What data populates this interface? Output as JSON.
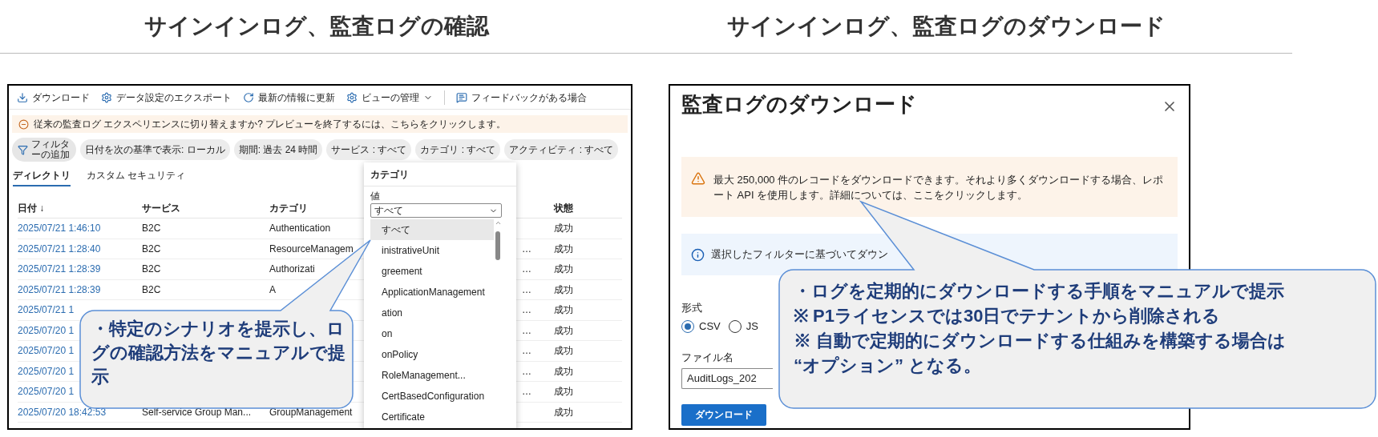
{
  "titles": [
    "サインインログ、監査ログの確認",
    "サインインログ、監査ログのダウンロード"
  ],
  "audit_view": {
    "toolbar": [
      {
        "kind": "download",
        "label": "ダウンロード"
      },
      {
        "kind": "export",
        "label": "データ設定のエクスポート"
      },
      {
        "kind": "refresh",
        "label": "最新の情報に更新"
      },
      {
        "kind": "view",
        "label": "ビューの管理"
      },
      {
        "kind": "feedback",
        "label": "フィードバックがある場合"
      }
    ],
    "banner": "従来の監査ログ エクスペリエンスに切り替えますか? プレビューを終了するには、こちらをクリックします。",
    "add_filter": "フィルターの追加",
    "filters": [
      "日付を次の基準で表示: ローカル",
      "期間: 過去 24 時間",
      "サービス : すべて",
      "カテゴリ : すべて",
      "アクティビティ : すべて"
    ],
    "tabs": [
      {
        "label": "ディレクトリ",
        "selected": true
      },
      {
        "label": "カスタム セキュリティ",
        "selected": false
      }
    ],
    "table": {
      "columns": [
        "日付 ↓",
        "サービス",
        "カテゴリ",
        "状態"
      ],
      "rows": [
        {
          "date": "2025/07/21 1:46:10",
          "service": "B2C",
          "category": "Authentication",
          "status": "成功"
        },
        {
          "date": "2025/07/21 1:28:40",
          "service": "B2C",
          "category": "ResourceManagem",
          "column_4": "…",
          "status": "成功"
        },
        {
          "date": "2025/07/21 1:28:39",
          "service": "B2C",
          "category": "Authorizati",
          "column_4": "…",
          "status": "成功"
        },
        {
          "date": "2025/07/21 1:28:39",
          "service": "B2C",
          "category": "A",
          "column_4": "…",
          "status": "成功"
        },
        {
          "date": "2025/07/21 1",
          "column_4": "…",
          "status": "成功"
        },
        {
          "date": "2025/07/20 1",
          "column_4": "…",
          "status": "成功"
        },
        {
          "date": "2025/07/20 1",
          "column_4": "…",
          "status": "成功"
        },
        {
          "date": "2025/07/20 1",
          "column_4": "…",
          "status": "成功"
        },
        {
          "date": "2025/07/20 1",
          "column_4": "…",
          "status": "成功"
        },
        {
          "date": "2025/07/20 18:42:53",
          "service": "Self-service Group Man...",
          "category": "GroupManagement",
          "status": "成功"
        }
      ]
    },
    "category_dropdown": {
      "title": "カテゴリ",
      "field_label": "値",
      "value": "すべて",
      "items": [
        {
          "label": "すべて",
          "selected": true
        },
        {
          "label": "inistrativeUnit",
          "selected": false
        },
        {
          "label": "greement",
          "selected": false
        },
        {
          "label": "ApplicationManagement",
          "selected": false
        },
        {
          "label": "ation",
          "selected": false
        },
        {
          "label": "on",
          "selected": false
        },
        {
          "label": "onPolicy",
          "selected": false
        },
        {
          "label": "RoleManagement...",
          "selected": false
        },
        {
          "label": "CertBasedConfiguration",
          "selected": false
        },
        {
          "label": "Certificate",
          "selected": false
        }
      ]
    },
    "callout": "・特定のシナリオを提示し、ログの確認方法をマニュアルで提示"
  },
  "download_dialog": {
    "title": "監査ログのダウンロード",
    "warning": "最大 250,000 件のレコードをダウンロードできます。それより多くダウンロードする場合、レポート API を使用します。詳細については、ここをクリックします。",
    "info": "選択したフィルターに基づいてダウン",
    "format_label": "形式",
    "formats": [
      {
        "label": "CSV",
        "selected": true
      },
      {
        "label": "JS",
        "selected": false
      }
    ],
    "filename_label": "ファイル名",
    "filename": "AuditLogs_202",
    "button": "ダウンロード",
    "callout": [
      "・ログを定期的にダウンロードする手順をマニュアルで提示",
      "※ P1ライセンスでは30日でテナントから削除される",
      "※ 自動で定期的にダウンロードする仕組みを構築する場合は",
      "“**オプション**” となる。"
    ]
  }
}
